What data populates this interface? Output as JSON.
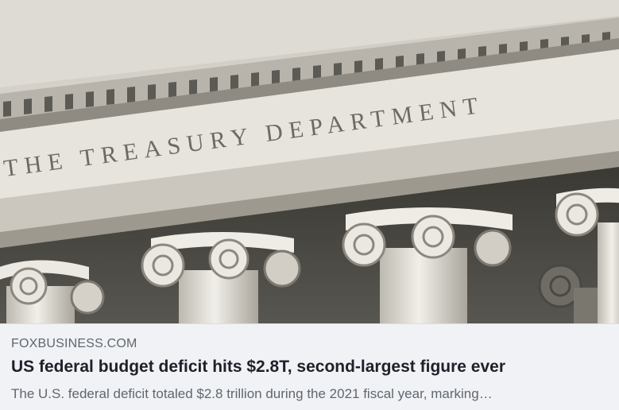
{
  "link_card": {
    "image": {
      "subject": "treasury-building-facade",
      "inscription": "THE TREASURY DEPARTMENT"
    },
    "domain": "FOXBUSINESS.COM",
    "title": "US federal budget deficit hits $2.8T, second-largest figure ever",
    "description": "The U.S. federal deficit totaled $2.8 trillion during the 2021 fiscal year, marking…"
  },
  "colors": {
    "background": "#f0f2f5",
    "title": "#1d2129",
    "secondary_text": "#606770",
    "stone": "#d9d6cf"
  }
}
